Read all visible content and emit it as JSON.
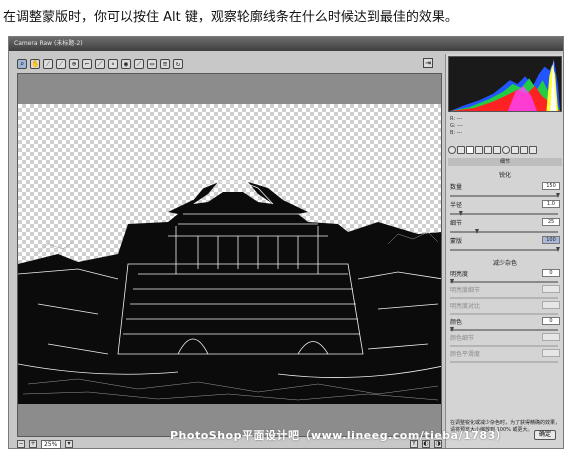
{
  "caption": "在调整蒙版时，你可以按住 Alt 键，观察轮廓线条在什么时候达到最佳的效果。",
  "window": {
    "title": "Camera Raw (未标题-2)"
  },
  "toolbar": {
    "tools": [
      "zoom-tool",
      "hand-tool",
      "white-balance-tool",
      "color-sampler-tool",
      "target-adjust-tool",
      "crop-tool",
      "straighten-tool",
      "spot-removal-tool",
      "red-eye-tool",
      "adjustment-brush",
      "graduated-filter",
      "preferences",
      "rotate"
    ],
    "exit_label": "⇥"
  },
  "rgb": {
    "r": "R: ---",
    "g": "G: ---",
    "b": "B: ---"
  },
  "panel": {
    "section_title": "细节",
    "sharpen_title": "锐化",
    "amount_label": "数量",
    "amount_value": "150",
    "amount_level": 1.0,
    "radius_label": "半径",
    "radius_value": "1.0",
    "radius_level": 0.1,
    "detail_label": "细节",
    "detail_value": "25",
    "detail_level": 0.25,
    "masking_label": "蒙版",
    "masking_value": "100",
    "masking_level": 1.0,
    "nr_title": "减少杂色",
    "lum_label": "明亮度",
    "lum_value": "0",
    "lum_detail_label": "明亮度细节",
    "lum_contrast_label": "明亮度对比",
    "color_label": "颜色",
    "color_value": "0",
    "color_detail_label": "颜色细节",
    "color_smooth_label": "颜色平滑度",
    "tip": "在调整锐化或减少杂色时，为了获得精确的效果，请将预览大小缩放到 100% 或更大。"
  },
  "status": {
    "zoom": "25%"
  },
  "ok_label": "确定",
  "watermark": "PhotoShop平面设计吧（www.lineeg.com/tieba/1783）",
  "colors": {
    "chrome": "#c8c8c8",
    "panel": "#d4d4d4",
    "histogram_bg": "#1a1a1a",
    "highlight": "#a8b8d8"
  }
}
